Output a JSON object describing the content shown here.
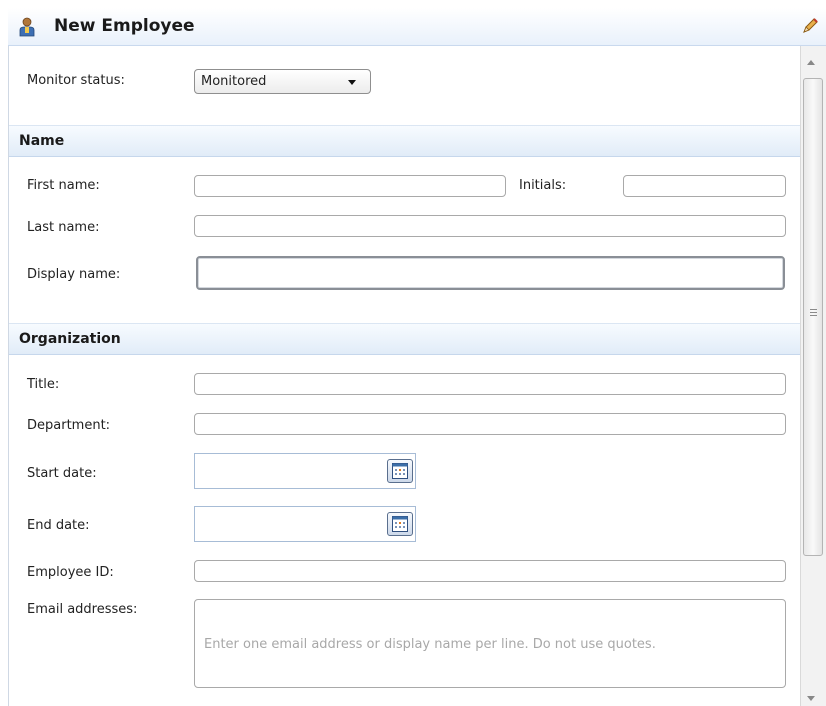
{
  "header": {
    "title": "New Employee",
    "icon": "employee-icon",
    "edit_icon": "pencil-icon"
  },
  "monitor": {
    "label": "Monitor status:",
    "value": "Monitored"
  },
  "sections": {
    "name": "Name",
    "organization": "Organization"
  },
  "fields": {
    "first_name": "First name:",
    "initials": "Initials:",
    "last_name": "Last name:",
    "display_name": "Display name:",
    "title": "Title:",
    "department": "Department:",
    "start_date": "Start date:",
    "end_date": "End date:",
    "employee_id": "Employee ID:",
    "email_addresses": "Email addresses:"
  },
  "email": {
    "placeholder": "Enter one email address or display name per line. Do not use quotes."
  },
  "colors": {
    "section_bg": "#e1ecf8",
    "border": "#a9a9a9",
    "placeholder": "#a8a8a8"
  }
}
